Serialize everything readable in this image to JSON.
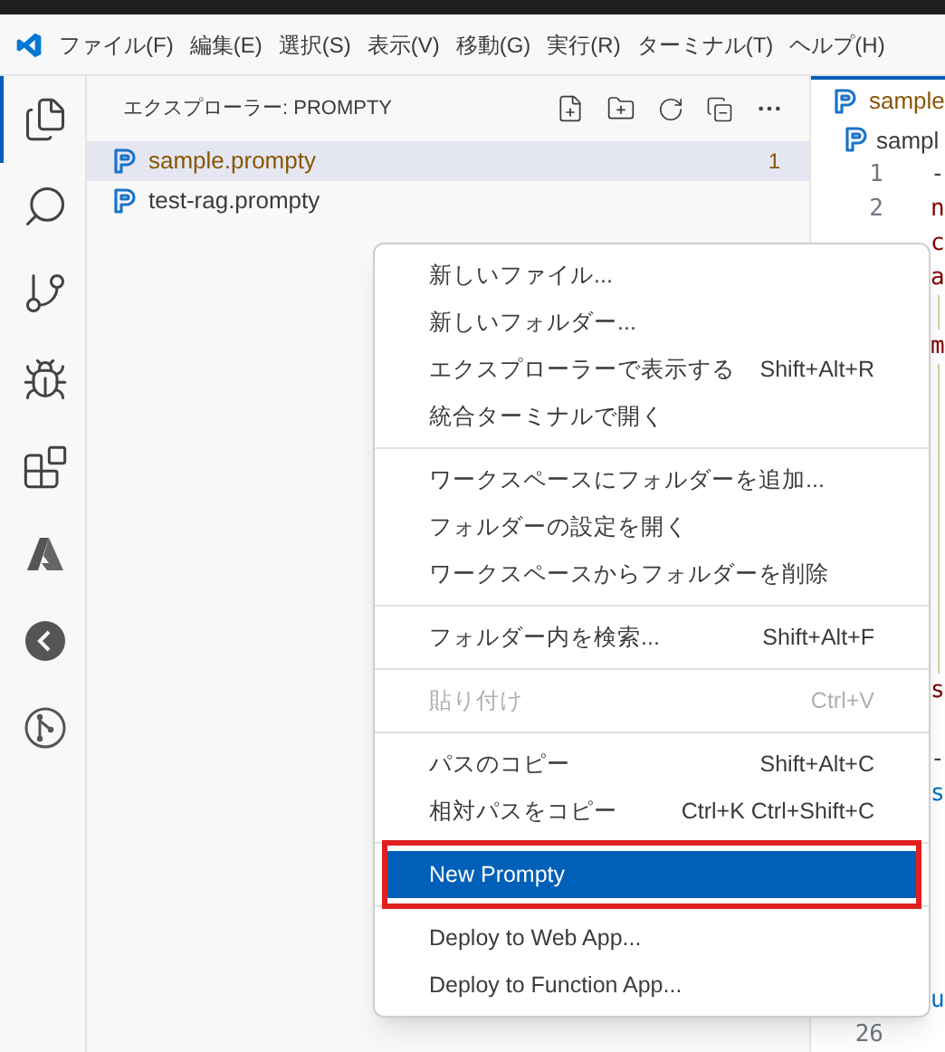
{
  "menu_bar": [
    "ファイル(F)",
    "編集(E)",
    "選択(S)",
    "表示(V)",
    "移動(G)",
    "実行(R)",
    "ターミナル(T)",
    "ヘルプ(H)"
  ],
  "activity_bar": [
    {
      "kind": "files",
      "selected": true
    },
    {
      "kind": "search",
      "selected": false
    },
    {
      "kind": "source-control",
      "selected": false
    },
    {
      "kind": "debug",
      "selected": false
    },
    {
      "kind": "extensions",
      "selected": false
    },
    {
      "kind": "azure",
      "selected": false
    },
    {
      "kind": "remote",
      "selected": false
    },
    {
      "kind": "graph",
      "selected": false
    }
  ],
  "sidebar": {
    "title": "エクスプローラー: PROMPTY",
    "files": [
      {
        "name": "sample.prompty",
        "badge": "1",
        "selected": true
      },
      {
        "name": "test-rag.prompty",
        "selected": false
      }
    ]
  },
  "editor": {
    "tab": "sample",
    "breadcrumb": "sampl",
    "lines": [
      {
        "number": "1",
        "text": "-",
        "color": "#3b3b3b"
      },
      {
        "number": "2",
        "text": "n",
        "color": "#800000"
      },
      {
        "text": "c",
        "color": "#800000"
      },
      {
        "text": "a",
        "color": "#800000"
      },
      {
        "kind": "guide"
      },
      {
        "text": "m",
        "color": "#800000"
      },
      {
        "kind": "guide"
      },
      {
        "kind": "guide"
      },
      {
        "kind": "guide"
      },
      {
        "kind": "guide"
      },
      {
        "kind": "guide"
      },
      {
        "kind": "guide"
      },
      {
        "kind": "guide"
      },
      {
        "kind": "guide"
      },
      {
        "kind": "guide"
      },
      {
        "text": "s",
        "color": "#800000"
      },
      {
        "kind": "blank"
      },
      {
        "text": "-",
        "color": "#3b3b3b"
      },
      {
        "text": "s",
        "color": "#0070c1"
      },
      {
        "kind": "blank"
      },
      {
        "kind": "blank"
      },
      {
        "kind": "blank"
      },
      {
        "kind": "blank"
      },
      {
        "kind": "blank"
      },
      {
        "text": "u",
        "color": "#0070c1"
      },
      {
        "number": "26"
      }
    ]
  },
  "context_menu": [
    [
      {
        "label": "新しいファイル..."
      },
      {
        "label": "新しいフォルダー..."
      },
      {
        "label": "エクスプローラーで表示する",
        "shortcut": "Shift+Alt+R"
      },
      {
        "label": "統合ターミナルで開く"
      }
    ],
    [
      {
        "label": "ワークスペースにフォルダーを追加..."
      },
      {
        "label": "フォルダーの設定を開く"
      },
      {
        "label": "ワークスペースからフォルダーを削除"
      }
    ],
    [
      {
        "label": "フォルダー内を検索...",
        "shortcut": "Shift+Alt+F"
      }
    ],
    [
      {
        "label": "貼り付け",
        "shortcut": "Ctrl+V",
        "disabled": true
      }
    ],
    [
      {
        "label": "パスのコピー",
        "shortcut": "Shift+Alt+C"
      },
      {
        "label": "相対パスをコピー",
        "shortcut": "Ctrl+K Ctrl+Shift+C"
      }
    ],
    [
      {
        "label": "New Prompty",
        "selected": true,
        "highlighted": true
      }
    ],
    [
      {
        "label": "Deploy to Web App..."
      },
      {
        "label": "Deploy to Function App..."
      }
    ]
  ]
}
